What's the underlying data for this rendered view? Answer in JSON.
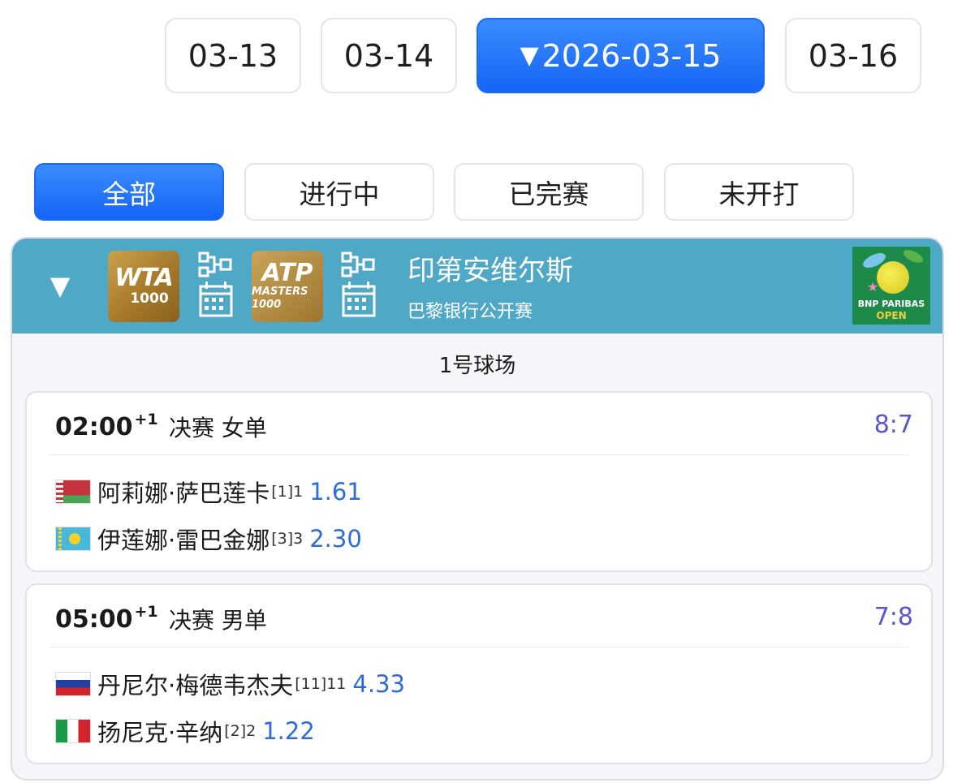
{
  "date_tabs": [
    {
      "label": "03-13",
      "active": false
    },
    {
      "label": "03-14",
      "active": false
    },
    {
      "label": "2026-03-15",
      "active": true
    },
    {
      "label": "03-16",
      "active": false
    }
  ],
  "active_indicator": "▼",
  "filters": [
    {
      "label": "全部",
      "active": true
    },
    {
      "label": "进行中",
      "active": false
    },
    {
      "label": "已完赛",
      "active": false
    },
    {
      "label": "未开打",
      "active": false
    }
  ],
  "tournament": {
    "collapse_icon": "▼",
    "badges": {
      "wta": {
        "line1": "WTA",
        "line2": "1000"
      },
      "atp": {
        "line1": "ATP",
        "line2": "MASTERS 1000"
      }
    },
    "name": "印第安维尔斯",
    "subtitle": "巴黎银行公开赛",
    "logo": {
      "line1": "BNP PARIBAS",
      "line2": "OPEN"
    },
    "header_color": "#4fa9c6",
    "court": "1号球场"
  },
  "matches": [
    {
      "time": "02:00",
      "day_offset": "+1",
      "round": "决赛",
      "event": "女单",
      "score": "8:7",
      "players": [
        {
          "flag": "belarus-flag-icon",
          "name": "阿莉娜·萨巴莲卡",
          "seed": "[1]1",
          "odds": "1.61"
        },
        {
          "flag": "kazakhstan-flag-icon",
          "name": "伊莲娜·雷巴金娜",
          "seed": "[3]3",
          "odds": "2.30"
        }
      ]
    },
    {
      "time": "05:00",
      "day_offset": "+1",
      "round": "决赛",
      "event": "男单",
      "score": "7:8",
      "players": [
        {
          "flag": "russia-flag-icon",
          "name": "丹尼尔·梅德韦杰夫",
          "seed": "[11]11",
          "odds": "4.33"
        },
        {
          "flag": "italy-flag-icon",
          "name": "扬尼克·辛纳",
          "seed": "[2]2",
          "odds": "1.22"
        }
      ]
    }
  ],
  "colors": {
    "accent": "#1a6cf7",
    "score": "#5a56c9",
    "odds": "#2b6dd8"
  }
}
